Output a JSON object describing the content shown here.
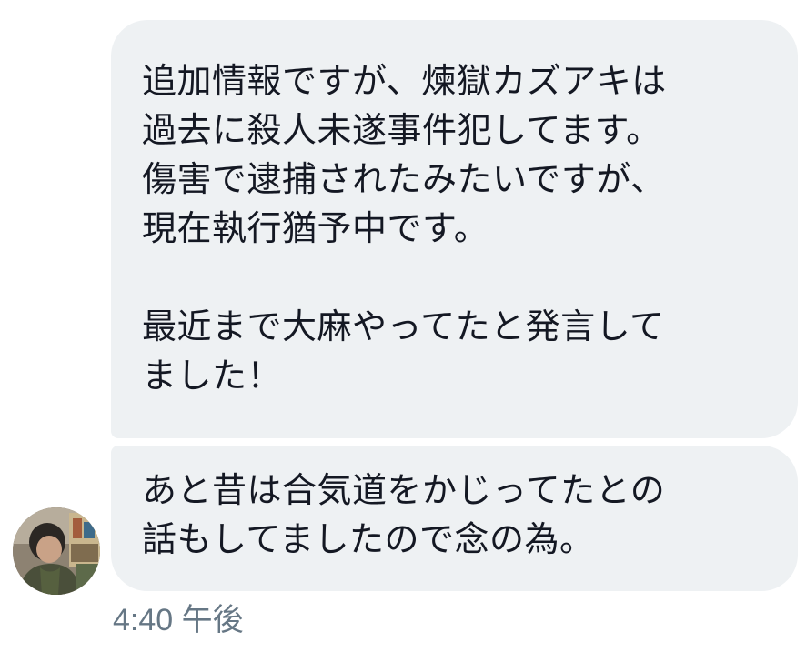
{
  "messages": [
    {
      "lines": [
        "追加情報ですが、煉獄カズアキは",
        "過去に殺人未遂事件犯してます。",
        "傷害で逮捕されたみたいですが、",
        "現在執行猶予中です。",
        "",
        "最近まで大麻やってたと発言して",
        "ました！"
      ]
    },
    {
      "lines": [
        "あと昔は合気道をかじってたとの",
        "話もしてましたので念の為。"
      ]
    }
  ],
  "timestamp": "4:40 午後",
  "colors": {
    "bubble": "#eef1f3",
    "text": "#141823",
    "timestamp": "#667785"
  },
  "icons": {
    "avatar": "user-photo-avatar"
  }
}
